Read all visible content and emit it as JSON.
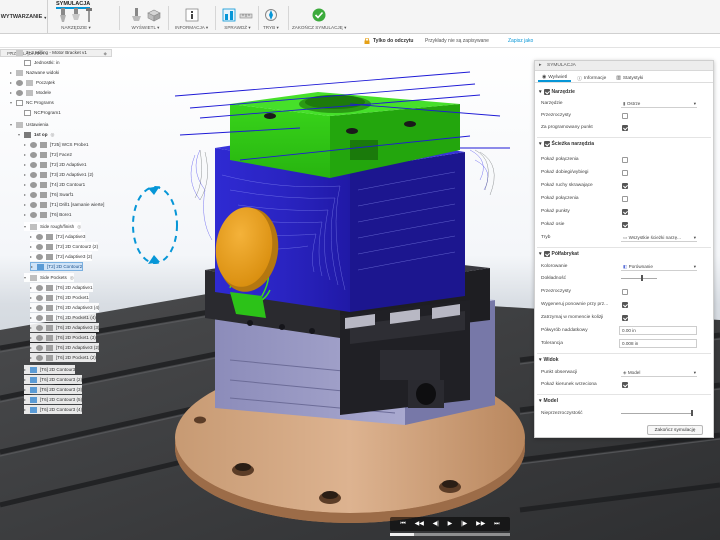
{
  "toolbar": {
    "workspace_label": "WYTWARZANIE",
    "active_tab": "SYMULACJA",
    "groups": [
      {
        "label": "NARZĘDZIE"
      },
      {
        "label": "WYŚWIETL"
      },
      {
        "label": "INFORMACJA"
      },
      {
        "label": "SPRAWDŹ"
      },
      {
        "label": "TRYB"
      },
      {
        "label": "ZAKOŃCZ SYMULACJĘ"
      }
    ]
  },
  "infobar": {
    "read_only": "Tylko do odczytu",
    "message": "Przykłady nie są zapisywane",
    "save_link": "Zapisz jako"
  },
  "browser": {
    "header": "PRZEGLĄDARKA",
    "rows": [
      {
        "label": "3+2 Milling - Motor Bracket v1"
      },
      {
        "label": "Jednostki: in"
      },
      {
        "label": "Nazwane widoki"
      },
      {
        "label": "Początek"
      },
      {
        "label": "Modele"
      },
      {
        "label": "NC Programs"
      },
      {
        "label": "NCProgram1"
      },
      {
        "label": "Ustawienia"
      },
      {
        "label": "1st op"
      },
      {
        "label": "[T25] WCS Probe1"
      },
      {
        "label": "[T2] Face2"
      },
      {
        "label": "[T2] 2D Adaptive1"
      },
      {
        "label": "[T3] 2D Adaptive1 (2)"
      },
      {
        "label": "[T4] 2D Contour1"
      },
      {
        "label": "[T6] Swarf1"
      },
      {
        "label": "[T1] Drill1 [samanie wierte]"
      },
      {
        "label": "[T6] Bore1"
      },
      {
        "label": "Side rough/finish"
      },
      {
        "label": "[T2] Adaptive3"
      },
      {
        "label": "[T2] 2D Contour2 (2)"
      },
      {
        "label": "[T2] Adaptive3 (2)"
      },
      {
        "label": "[T2] 2D Contour2"
      },
      {
        "label": "Side Pockets"
      },
      {
        "label": "[T6] 2D Adaptive1"
      },
      {
        "label": "[T6] 2D Pocket1"
      },
      {
        "label": "[T6] 2D Adaptive3 (4)"
      },
      {
        "label": "[T6] 2D Pocket1 (4)"
      },
      {
        "label": "[T6] 2D Adaptive3 (3)"
      },
      {
        "label": "[T6] 2D Pocket1 (3)"
      },
      {
        "label": "[T6] 2D Adaptive3 (2)"
      },
      {
        "label": "[T6] 2D Pocket1 (2)"
      },
      {
        "label": "[T6] 2D Contour3"
      },
      {
        "label": "[T6] 2D Contour3 (2)"
      },
      {
        "label": "[T6] 2D Contour3 (3)"
      },
      {
        "label": "[T6] 2D Contour3 (5)"
      },
      {
        "label": "[T6] 2D Contour3 (4)"
      }
    ]
  },
  "sim_panel": {
    "title": "SYMULACJA",
    "tabs": [
      "Wyświetl",
      "Informacje",
      "Statystyki"
    ],
    "sections": {
      "tool": "Narzędzie",
      "toolpath": "Ścieżka narzędzia",
      "stock": "Półfabrykat",
      "view": "Widok",
      "model": "Model"
    },
    "tool_rows": {
      "tool": "Narzędzie",
      "tool_value": "Ostrze",
      "transparent": "Przezroczysty",
      "for_programmed_point": "Za programowany punkt"
    },
    "toolpath_rows": {
      "show_links": "Pokaż połączenia",
      "show_entry_exit": "Pokaż dobiegi/wybiegi",
      "show_rapid": "Pokaż ruchy skrawające",
      "show_connections": "Pokaż połączenia",
      "show_points": "Pokaż punkty",
      "show_axes": "Pokaż osie",
      "mode": "Tryb",
      "mode_value": "Wszystkie ścieżki narzę..."
    },
    "stock_rows": {
      "coloring": "Kolorowanie",
      "coloring_value": "Porównanie",
      "accuracy": "Dokładność",
      "transparent": "Przezroczysty",
      "regenerate": "Wygeneruj ponownie przy prz...",
      "stop_on_collision": "Zatrzymaj w momencie kolizji",
      "finish_offset": "Półwyrób naddatkowy",
      "finish_offset_value": "0.00 in",
      "tolerance": "Tolerancja",
      "tolerance_value": "0.008 in"
    },
    "view_rows": {
      "view_point": "Punkt obserwacji",
      "view_point_value": "Model",
      "show_spindle_direction": "Pokaż kierunek wrzeciona"
    },
    "model_rows": {
      "opacity": "Nieprzezroczystość"
    },
    "close_button": "Zakończ symulację"
  },
  "playback": {
    "progress": 0.2
  }
}
